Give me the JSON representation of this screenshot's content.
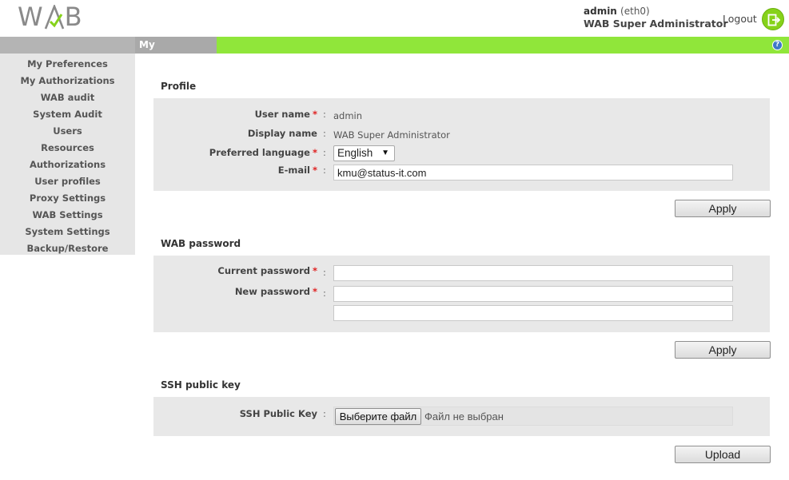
{
  "header": {
    "logo_left": "W",
    "logo_right": "B",
    "user": "admin",
    "interface": "(eth0)",
    "role": "WAB Super Administrator",
    "logout_label": "Logout",
    "brand_green": "#90e63a"
  },
  "titlebar": {
    "tab": "My Preferences",
    "help": "?"
  },
  "sidebar": {
    "items": [
      {
        "label": "My Preferences"
      },
      {
        "label": "My Authorizations"
      },
      {
        "label": "WAB audit"
      },
      {
        "label": "System Audit"
      },
      {
        "label": "Users"
      },
      {
        "label": "Resources"
      },
      {
        "label": "Authorizations"
      },
      {
        "label": "User profiles"
      },
      {
        "label": "Proxy Settings"
      },
      {
        "label": "WAB Settings"
      },
      {
        "label": "System Settings"
      },
      {
        "label": "Backup/Restore"
      }
    ]
  },
  "profile": {
    "title": "Profile",
    "username_label": "User name",
    "username_value": "admin",
    "display_label": "Display name",
    "display_value": "WAB Super Administrator",
    "language_label": "Preferred language",
    "language_value": "English",
    "email_label": "E-mail",
    "email_value": "kmu@status-it.com",
    "apply": "Apply"
  },
  "password": {
    "title": "WAB password",
    "current_label": "Current password",
    "new_label": "New password",
    "apply": "Apply"
  },
  "ssh": {
    "title": "SSH public key",
    "key_label": "SSH Public Key",
    "choose_file": "Выберите файл",
    "no_file": "Файл не выбран",
    "upload": "Upload"
  },
  "common": {
    "required": "*",
    "colon": ":"
  }
}
